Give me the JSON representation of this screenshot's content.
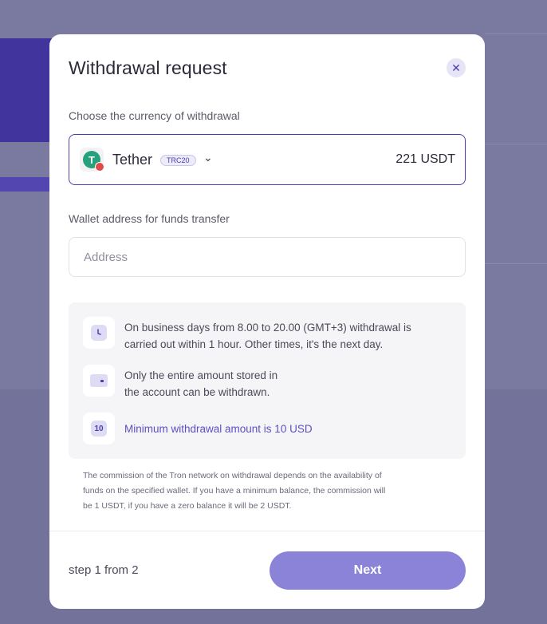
{
  "modal": {
    "title": "Withdrawal request",
    "close_icon": "close-icon"
  },
  "currency": {
    "label": "Choose the currency of withdrawal",
    "coin_symbol": "T",
    "name": "Tether",
    "network": "TRC20",
    "balance": "221 USDT",
    "icon": "tether-icon",
    "chevron": "chevron-down-icon"
  },
  "address": {
    "label": "Wallet address for funds transfer",
    "placeholder": "Address",
    "value": ""
  },
  "info": {
    "items": [
      {
        "icon": "clock-icon",
        "line1": "On business days from 8.00 to 20.00 (GMT+3) withdrawal is",
        "line2": "carried out within 1 hour. Other times, it's the next day."
      },
      {
        "icon": "wallet-icon",
        "line1": "Only the entire amount stored in",
        "line2": "the account can be withdrawn."
      },
      {
        "icon": "min-amount-icon",
        "icon_text": "10",
        "line1": "Minimum withdrawal amount is 10 USD"
      }
    ]
  },
  "note": {
    "line1": "The commission of the Tron network on withdrawal depends on the availability of",
    "line2": "funds on the specified wallet. If you have a minimum balance, the commission will",
    "line3": "be 1 USDT, if you have a zero balance it will be 2 USDT."
  },
  "footer": {
    "step": "step 1 from 2",
    "next_label": "Next"
  },
  "colors": {
    "accent": "#4b3fa8",
    "button": "#8a83d8",
    "overlay": "#7a79a0",
    "tether": "#26a17b"
  }
}
